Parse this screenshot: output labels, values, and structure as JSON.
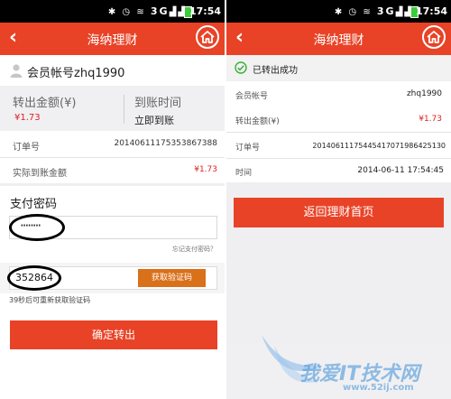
{
  "status_bar": {
    "network": "3G",
    "time": "17:54"
  },
  "left": {
    "header_title": "海纳理财",
    "account_label": "会员帐号zhq1990",
    "transfer_amount_label": "转出金额(¥)",
    "transfer_amount_value": "¥1.73",
    "arrival_time_label": "到账时间",
    "arrival_time_value": "立即到账",
    "order_no_label": "订单号",
    "order_no_value": "20140611175353867388",
    "actual_amount_label": "实际到账金额",
    "actual_amount_value": "¥1.73",
    "pay_password_label": "支付密码",
    "password_value": "········",
    "forgot_password": "忘记支付密码？",
    "verify_code_value": "352864",
    "get_code_button": "获取验证码",
    "resend_hint": "39秒后可重新获取验证码",
    "confirm_button": "确定转出"
  },
  "right": {
    "header_title": "海纳理财",
    "success_text": "已转出成功",
    "rows": [
      {
        "label": "会员帐号",
        "value": "zhq1990"
      },
      {
        "label": "转出金额(¥)",
        "value": "¥1.73"
      },
      {
        "label": "订单号",
        "value": "20140611175445417071986425130"
      },
      {
        "label": "时间",
        "value": "2014-06-11 17:54:45"
      }
    ],
    "return_button": "返回理财首页"
  },
  "watermark": {
    "main": "我爱IT技术网",
    "url": "www.52ij.com"
  },
  "colors": {
    "header_red": "#e84327",
    "amount_red": "#e02020",
    "code_button": "#d9701a",
    "success_green": "#38b038"
  }
}
